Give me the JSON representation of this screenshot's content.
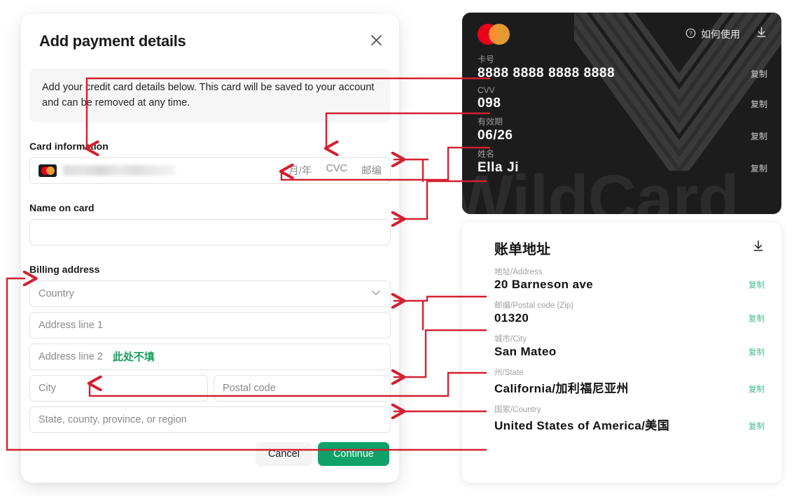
{
  "modal": {
    "title": "Add payment details",
    "close_icon": "close-icon",
    "notice": "Add your credit card details below. This card will be saved to your account and can be removed at any time.",
    "card_information_label": "Card information",
    "card_number_placeholder": "",
    "card_brand_icon": "mastercard-icon",
    "card_hints": [
      "月/年",
      "CVC",
      "邮编"
    ],
    "name_on_card_label": "Name on card",
    "name_on_card_value": "",
    "billing_address_label": "Billing address",
    "country_placeholder": "Country",
    "country_chevron_icon": "chevron-down-icon",
    "address1_placeholder": "Address line 1",
    "address2_placeholder": "Address line 2",
    "address2_note": "此处不填",
    "city_placeholder": "City",
    "postal_placeholder": "Postal code",
    "state_placeholder": "State, county, province, or region",
    "cancel_label": "Cancel",
    "continue_label": "Continue",
    "accent_continue": "#10a06a",
    "accent_note_green": "#18a05c"
  },
  "card_panel": {
    "brand_icon": "mastercard-icon",
    "help_icon": "question-circle-icon",
    "help_label": "如何使用",
    "download_icon": "download-icon",
    "watermark_text": "WildCard",
    "rows": [
      {
        "key": "卡号",
        "value": "8888 8888 8888 8888",
        "copy": "复制"
      },
      {
        "key": "CVV",
        "value": "098",
        "copy": "复制"
      },
      {
        "key": "有效期",
        "value": "06/26",
        "copy": "复制"
      },
      {
        "key": "姓名",
        "value": "Ella Ji",
        "copy": "复制"
      }
    ],
    "background": "#1c1c1c"
  },
  "billing_panel": {
    "title": "账单地址",
    "download_icon": "download-icon",
    "rows": [
      {
        "key": "地址/Address",
        "value": "20 Barneson ave",
        "copy": "复制"
      },
      {
        "key": "邮编/Postal code (Zip)",
        "value": "01320",
        "copy": "复制"
      },
      {
        "key": "城市/City",
        "value": "San Mateo",
        "copy": "复制"
      },
      {
        "key": "州/State",
        "value": "California/加利福尼亚州",
        "copy": "复制"
      },
      {
        "key": "国家/Country",
        "value": "United States of America/美国",
        "copy": "复制"
      }
    ],
    "copy_color": "#3fbf87"
  },
  "annotations": {
    "color": "#d32030",
    "description": "Red arrows mapping WildCard virtual card values on the right into the Stripe payment form fields on the left."
  }
}
